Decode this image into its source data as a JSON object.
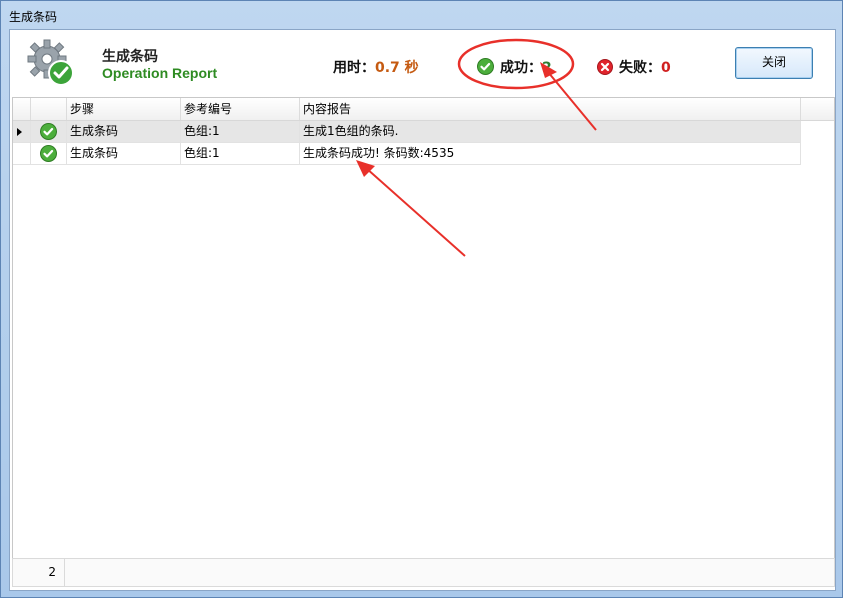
{
  "window": {
    "title": "生成条码"
  },
  "header": {
    "title": "生成条码",
    "subtitle": "Operation Report",
    "time_label": "用时：",
    "time_value": "0.7 秒",
    "success_label": "成功：",
    "success_value": "2",
    "fail_label": "失败：",
    "fail_value": "0",
    "close_label": "关闭"
  },
  "grid": {
    "columns": [
      "步骤",
      "参考编号",
      "内容报告"
    ],
    "rows": [
      {
        "status": "success",
        "step": "生成条码",
        "ref": "色组:1",
        "report": "生成1色组的条码."
      },
      {
        "status": "success",
        "step": "生成条码",
        "ref": "色组:1",
        "report": "生成条码成功! 条码数:4535"
      }
    ]
  },
  "footer": {
    "count": "2"
  },
  "colors": {
    "accent_green": "#2e8b22",
    "time_orange": "#c55a11",
    "fail_red": "#d02020",
    "annotation_red": "#e8302a"
  }
}
